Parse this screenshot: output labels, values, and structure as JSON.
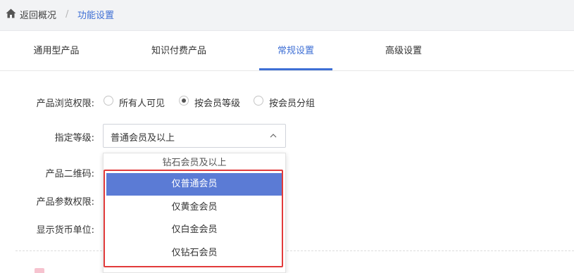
{
  "breadcrumb": {
    "back": "返回概况",
    "separator": "/",
    "current": "功能设置"
  },
  "tabs": [
    {
      "label": "通用型产品",
      "active": false
    },
    {
      "label": "知识付费产品",
      "active": false
    },
    {
      "label": "常规设置",
      "active": true
    },
    {
      "label": "高级设置",
      "active": false
    }
  ],
  "form": {
    "browse_permission": {
      "label": "产品浏览权限:",
      "options": [
        {
          "label": "所有人可见",
          "checked": false
        },
        {
          "label": "按会员等级",
          "checked": true
        },
        {
          "label": "按会员分组",
          "checked": false
        }
      ]
    },
    "level": {
      "label": "指定等级:",
      "value": "普通会员及以上"
    },
    "qrcode": {
      "label": "产品二维码:"
    },
    "params_permission": {
      "label": "产品参数权限:"
    },
    "currency_unit": {
      "label": "显示货币单位:"
    }
  },
  "dropdown": {
    "partial_top": "钻石会员及以上",
    "items": [
      {
        "label": "仅普通会员",
        "selected": true
      },
      {
        "label": "仅黄金会员",
        "selected": false
      },
      {
        "label": "仅白金会员",
        "selected": false
      },
      {
        "label": "仅钻石会员",
        "selected": false
      }
    ]
  },
  "colors": {
    "accent": "#3e6fd5",
    "selected_item_bg": "#5b7bd5",
    "highlight_border": "#e23b3b"
  }
}
